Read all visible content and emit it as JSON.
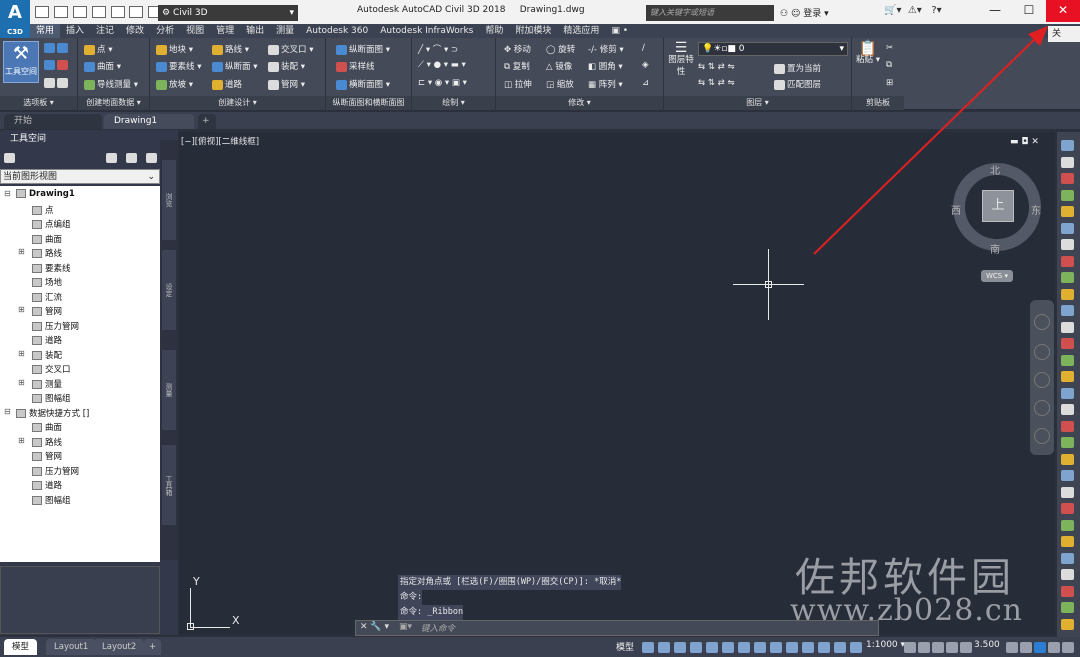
{
  "app": {
    "logo_text": "A",
    "logo_sub": "C3D",
    "workspace": "Civil 3D",
    "title": "Autodesk AutoCAD Civil 3D 2018",
    "document": "Drawing1.dwg",
    "search_placeholder": "键入关键字或短语",
    "login": "登录",
    "side_tab": "关"
  },
  "window_controls": [
    "—",
    "☐",
    "✕"
  ],
  "menu_tabs": [
    "常用",
    "插入",
    "注记",
    "修改",
    "分析",
    "视图",
    "管理",
    "输出",
    "测量",
    "Autodesk 360",
    "Autodesk InfraWorks",
    "帮助",
    "附加模块",
    "精选应用",
    "▣ •"
  ],
  "ribbon": {
    "toolspace": "工具空间",
    "panels": [
      {
        "label": "选项板 ▾"
      },
      {
        "label": "创建地面数据 ▾",
        "items": [
          "点 ▾",
          "曲面 ▾",
          "导线测量 ▾"
        ]
      },
      {
        "label": "创建设计 ▾",
        "items": [
          "地块 ▾",
          "路线 ▾",
          "交叉口 ▾",
          "要素线 ▾",
          "纵断面 ▾",
          "装配 ▾",
          "放坡 ▾",
          "道路",
          "管网 ▾"
        ]
      },
      {
        "label": "纵断面图和横断面图",
        "items": [
          "纵断面图 ▾",
          "采样线",
          "横断面图 ▾"
        ]
      },
      {
        "label": "绘制 ▾"
      },
      {
        "label": "修改 ▾",
        "items": [
          "移动",
          "旋转",
          "修剪 ▾",
          "复制",
          "镜像",
          "圆角 ▾",
          "拉伸",
          "缩放",
          "阵列 ▾"
        ]
      },
      {
        "label": "图层 ▾",
        "items": [
          "图层特性",
          "置为当前",
          "匹配图层"
        ],
        "combo": "0"
      },
      {
        "label": "剪贴板",
        "items": [
          "粘贴"
        ]
      }
    ]
  },
  "doc_tabs": [
    "开始",
    "Drawing1",
    "+"
  ],
  "palette": {
    "title": "工具空间",
    "view": "当前图形视图",
    "vertical_tabs": [
      "浏览",
      "设定",
      "测量",
      "工具箱"
    ],
    "tree": [
      {
        "label": "Drawing1",
        "level": 0,
        "bold": true,
        "exp": "⊟"
      },
      {
        "label": "点",
        "level": 1
      },
      {
        "label": "点编组",
        "level": 1
      },
      {
        "label": "曲面",
        "level": 1
      },
      {
        "label": "路线",
        "level": 1,
        "exp": "⊞"
      },
      {
        "label": "要素线",
        "level": 1
      },
      {
        "label": "场地",
        "level": 1
      },
      {
        "label": "汇流",
        "level": 1
      },
      {
        "label": "管网",
        "level": 1,
        "exp": "⊞"
      },
      {
        "label": "压力管网",
        "level": 1
      },
      {
        "label": "道路",
        "level": 1
      },
      {
        "label": "装配",
        "level": 1,
        "exp": "⊞"
      },
      {
        "label": "交叉口",
        "level": 1
      },
      {
        "label": "测量",
        "level": 1,
        "exp": "⊞"
      },
      {
        "label": "图幅组",
        "level": 1
      },
      {
        "label": "数据快捷方式 []",
        "level": 0,
        "exp": "⊟"
      },
      {
        "label": "曲面",
        "level": 1
      },
      {
        "label": "路线",
        "level": 1,
        "exp": "⊞"
      },
      {
        "label": "管网",
        "level": 1
      },
      {
        "label": "压力管网",
        "level": 1
      },
      {
        "label": "道路",
        "level": 1
      },
      {
        "label": "图幅组",
        "level": 1
      }
    ]
  },
  "viewport": {
    "label": "[−][俯视][二维线框]",
    "controls": "▬ ◘ ✕",
    "compass": {
      "north": "北",
      "south": "南",
      "west": "西",
      "east": "东",
      "center": "上"
    },
    "wcs": "WCS ▾",
    "ucs_x": "X",
    "ucs_y": "Y"
  },
  "command": {
    "history": [
      "指定对角点或 [栏选(F)/圈围(WP)/圈交(CP)]: *取消*",
      "命令:",
      "命令: _Ribbon"
    ],
    "placeholder": "键入命令",
    "bar_icons": "✕ 🔧 ▾"
  },
  "watermark": {
    "line1": "佐邦软件园",
    "line2": "www.zb028.cn"
  },
  "layout_tabs": [
    "模型",
    "Layout1",
    "Layout2",
    "+"
  ],
  "status": {
    "model": "模型",
    "scale": "1:1000 ▾",
    "number": "3.500"
  },
  "colors": {
    "accent": "#1e6fb0",
    "close": "#e81123",
    "arrow": "#e02020"
  }
}
